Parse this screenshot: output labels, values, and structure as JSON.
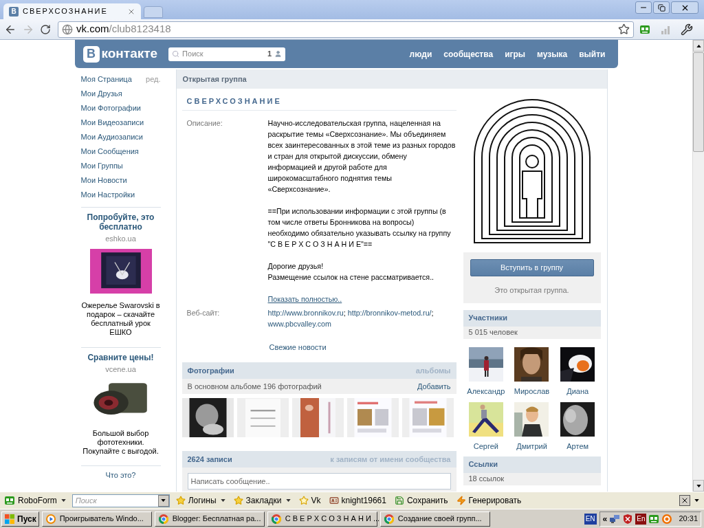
{
  "browser": {
    "tabs": [
      {
        "icon_letter": "В",
        "title": "СВЕРХСОЗНАНИЕ",
        "selected": true
      }
    ],
    "forward": {
      "disabled": true
    },
    "url_domain": "vk.com",
    "url_path": "/club8123418"
  },
  "header": {
    "logo_letter": "В",
    "logo_text": "контакте",
    "search_placeholder": "Поиск",
    "search_count": "1",
    "nav": [
      "люди",
      "сообщества",
      "игры",
      "музыка",
      "выйти"
    ]
  },
  "sidebar": {
    "items": [
      "Моя Страница",
      "Мои Друзья",
      "Мои Фотографии",
      "Мои Видеозаписи",
      "Мои Аудиозаписи",
      "Мои Сообщения",
      "Мои Группы",
      "Мои Новости",
      "Мои Настройки"
    ],
    "edit_link": "ред.",
    "ads": [
      {
        "title": "Попробуйте, это бесплатно",
        "domain": "eshko.ua",
        "text": "Ожерелье Swarovski в подарок – скачайте бесплатный урок ЕШКО"
      },
      {
        "title": "Сравните цены!",
        "domain": "vcene.ua",
        "text": "Большой выбор фототехники. Покупайте с выгодой."
      }
    ],
    "what_is_this": "Что это?"
  },
  "group": {
    "type_label": "Открытая группа",
    "name": "СВЕРХСОЗНАНИЕ",
    "description_label": "Описание:",
    "description": [
      "Научно-исследовательская группа, нацеленная на раскрытие темы «Сверхсознание». Мы объединяем всех заинтересованных в этой теме из разных городов и стран для открытой дискуссии, обмену информацией и другой работе для широкомасштабного поднятия темы «Сверхсознание».",
      "==При использовании информации с этой группы (в том числе ответы Бронникова на вопросы) необходимо обязательно указывать ссылку на группу \"С В Е Р Х С О З Н А Н И Е\"==",
      "Дорогие друзья!\nРазмещение ссылок на стене рассматривается.."
    ],
    "more_link": "Показать полностью..",
    "website_label": "Веб-сайт:",
    "websites": [
      {
        "text": "http://www.bronnikov.ru",
        "suffix": ";"
      },
      {
        "text": "http://bronnikov-metod.ru/",
        "suffix": ";"
      },
      {
        "text": "www.pbcvalley.com"
      }
    ],
    "news_link": "Свежие новости"
  },
  "photos": {
    "title": "Фотографии",
    "albums_link": "альбомы",
    "subtitle": "В основном альбоме 196 фотографий",
    "add_link": "Добавить"
  },
  "wall": {
    "title": "2624 записи",
    "link": "к записям от имени сообщества",
    "placeholder": "Написать сообщение.."
  },
  "join": {
    "button": "Вступить в группу",
    "note": "Это открытая группа."
  },
  "members": {
    "title": "Участники",
    "count": "5 015 человек",
    "people": [
      {
        "name": "Александр"
      },
      {
        "name": "Мирослав"
      },
      {
        "name": "Диана"
      },
      {
        "name": "Сергей"
      },
      {
        "name": "Дмитрий"
      },
      {
        "name": "Артем"
      }
    ]
  },
  "links": {
    "title": "Ссылки",
    "count": "18 ссылок"
  },
  "roboform": {
    "search_placeholder": "Поиск",
    "items": [
      {
        "kind": "menu",
        "label": "RoboForm"
      },
      {
        "kind": "search"
      },
      {
        "kind": "menu",
        "label": "Логины"
      },
      {
        "kind": "menu",
        "label": "Закладки"
      },
      {
        "kind": "button",
        "label": "Vk"
      },
      {
        "kind": "button",
        "label": "knight19661"
      },
      {
        "kind": "button",
        "label": "Сохранить"
      },
      {
        "kind": "button",
        "label": "Генерировать"
      }
    ]
  },
  "taskbar": {
    "start": "Пуск",
    "windows": [
      {
        "title": "Проигрыватель Windo..."
      },
      {
        "title": "Blogger: Бесплатная ра..."
      },
      {
        "title": "С В Е Р Х С О З Н А Н И ..."
      },
      {
        "title": "Создание своей групп..."
      }
    ],
    "language": "EN",
    "tray_expand": "«",
    "tray_badge": "En",
    "clock": "20:31"
  }
}
